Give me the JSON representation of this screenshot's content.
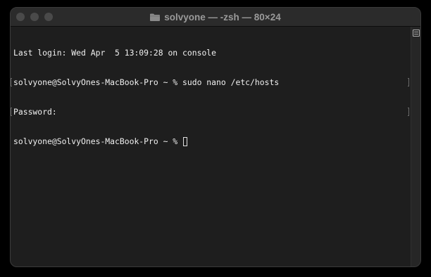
{
  "window": {
    "title": "solvyone — -zsh — 80×24",
    "title_icon": "folder-icon"
  },
  "terminal": {
    "lines": [
      "Last login: Wed Apr  5 13:09:28 on console",
      "solvyone@SolvyOnes-MacBook-Pro ~ % sudo nano /etc/hosts",
      "Password:",
      "solvyone@SolvyOnes-MacBook-Pro ~ % "
    ],
    "cursor": "block-cursor"
  },
  "scrollbar": {
    "icon": "split-pane-icon"
  },
  "colors": {
    "background": "#1e1e1e",
    "text": "#f0f0f0",
    "titlebar": "#2b2b2b",
    "title_text": "#9a9a9a"
  }
}
